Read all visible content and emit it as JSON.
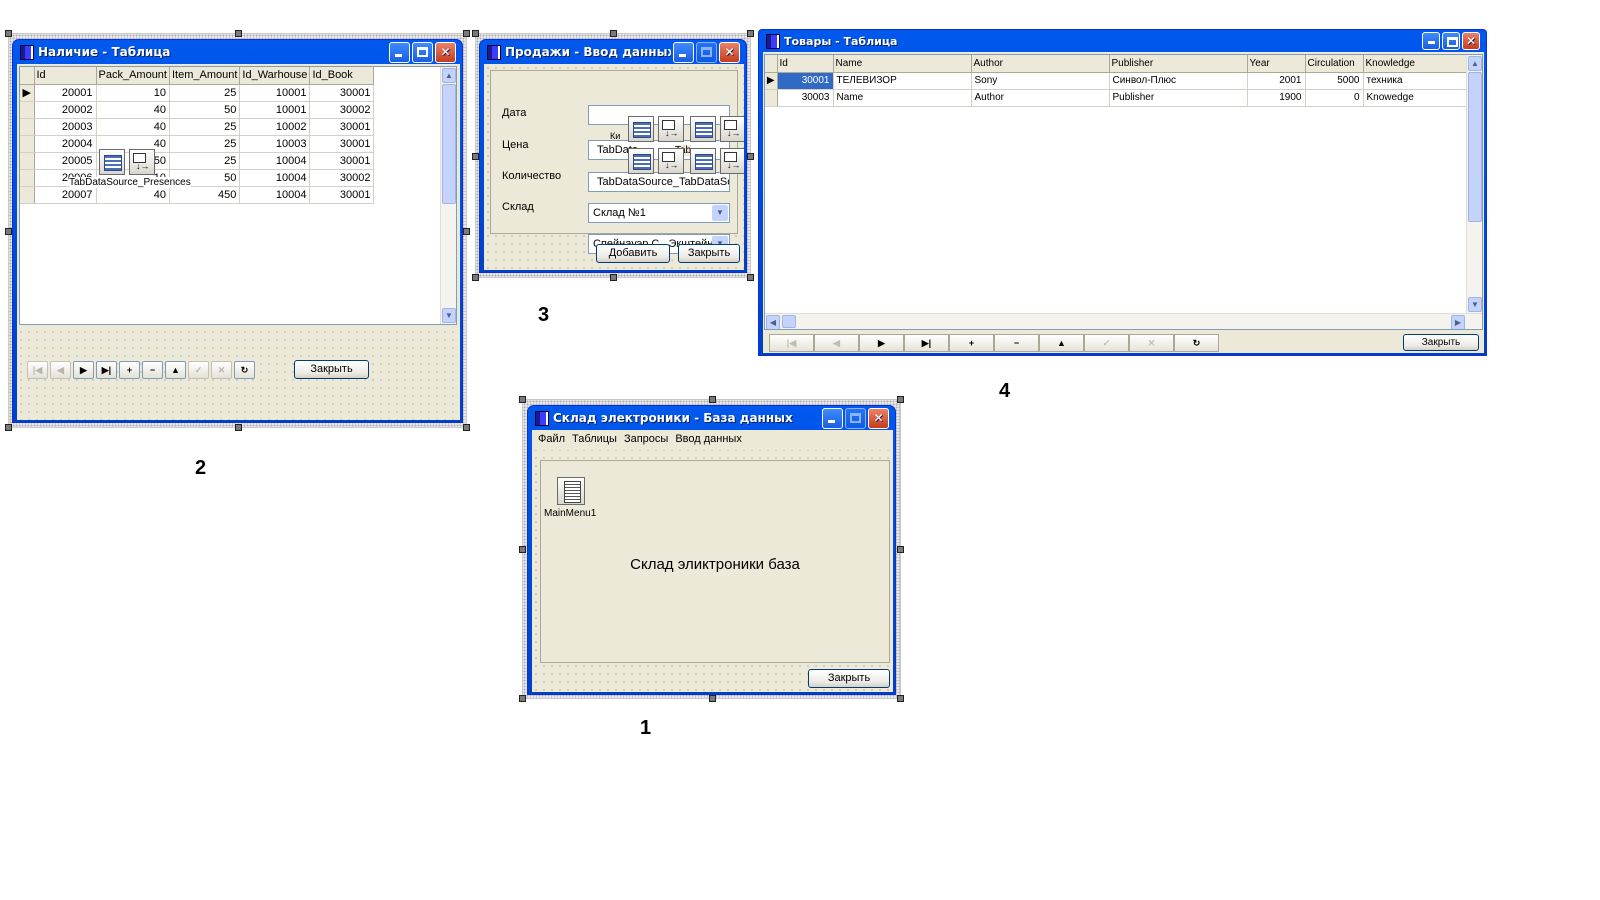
{
  "window2": {
    "title": "Наличие - Таблица",
    "columns": [
      "Id",
      "Pack_Amount",
      "Item_Amount",
      "Id_Warhouse",
      "Id_Book"
    ],
    "rows": [
      [
        "20001",
        "10",
        "25",
        "10001",
        "30001"
      ],
      [
        "20002",
        "40",
        "50",
        "10001",
        "30002"
      ],
      [
        "20003",
        "40",
        "25",
        "10002",
        "30001"
      ],
      [
        "20004",
        "40",
        "25",
        "10003",
        "30001"
      ],
      [
        "20005",
        "50",
        "25",
        "10004",
        "30001"
      ],
      [
        "20006",
        "10",
        "50",
        "10004",
        "30002"
      ],
      [
        "20007",
        "40",
        "450",
        "10004",
        "30001"
      ]
    ],
    "component_label": "TabDataSource_Presences",
    "close_label": "Закрыть",
    "nav_buttons": [
      "|◀",
      "◀",
      "▶",
      "▶|",
      "+",
      "−",
      "▲",
      "✓",
      "✕",
      "↻"
    ]
  },
  "window3": {
    "title": "Продажи - Ввод данных",
    "label_date": "Дата",
    "label_price": "Цена",
    "label_qty": "Количество",
    "label_warehouse": "Склад",
    "price_value": "TabData",
    "price_overlay": "Tab",
    "small_label": "Ки",
    "qty_value": "TabDataSource_TabDataSource_",
    "warehouse_value": "Склад №1",
    "book_value": "Спейнауэр С., Экштейн",
    "add_label": "Добавить",
    "close_label": "Закрыть"
  },
  "window4": {
    "title": "Товары - Таблица",
    "columns": [
      "Id",
      "Name",
      "Author",
      "Publisher",
      "Year",
      "Circulation",
      "Knowledge"
    ],
    "rows": [
      [
        "30001",
        "ТЕЛЕВИЗОР",
        "Sony",
        "Синвол-Плюс",
        "2001",
        "5000",
        "техника"
      ],
      [
        "30003",
        "Name",
        "Author",
        "Publisher",
        "1900",
        "0",
        "Knowedge"
      ]
    ],
    "nav_buttons": [
      "|◀",
      "◀",
      "▶",
      "▶|",
      "+",
      "−",
      "▲",
      "✓",
      "✕",
      "↻"
    ],
    "close_label": "Закрыть"
  },
  "window1": {
    "title": "Склад электроники - База данных",
    "menu": [
      "Файл",
      "Таблицы",
      "Запросы",
      "Ввод данных"
    ],
    "component_label": "MainMenu1",
    "main_text": "Склад эликтроники  база",
    "close_label": "Закрыть"
  },
  "captions": {
    "n1": "1",
    "n2": "2",
    "n3": "3",
    "n4": "4"
  },
  "colors": {
    "title_bar": "#0058ee",
    "client": "#ece9d8",
    "close_button": "#c63c1c"
  }
}
